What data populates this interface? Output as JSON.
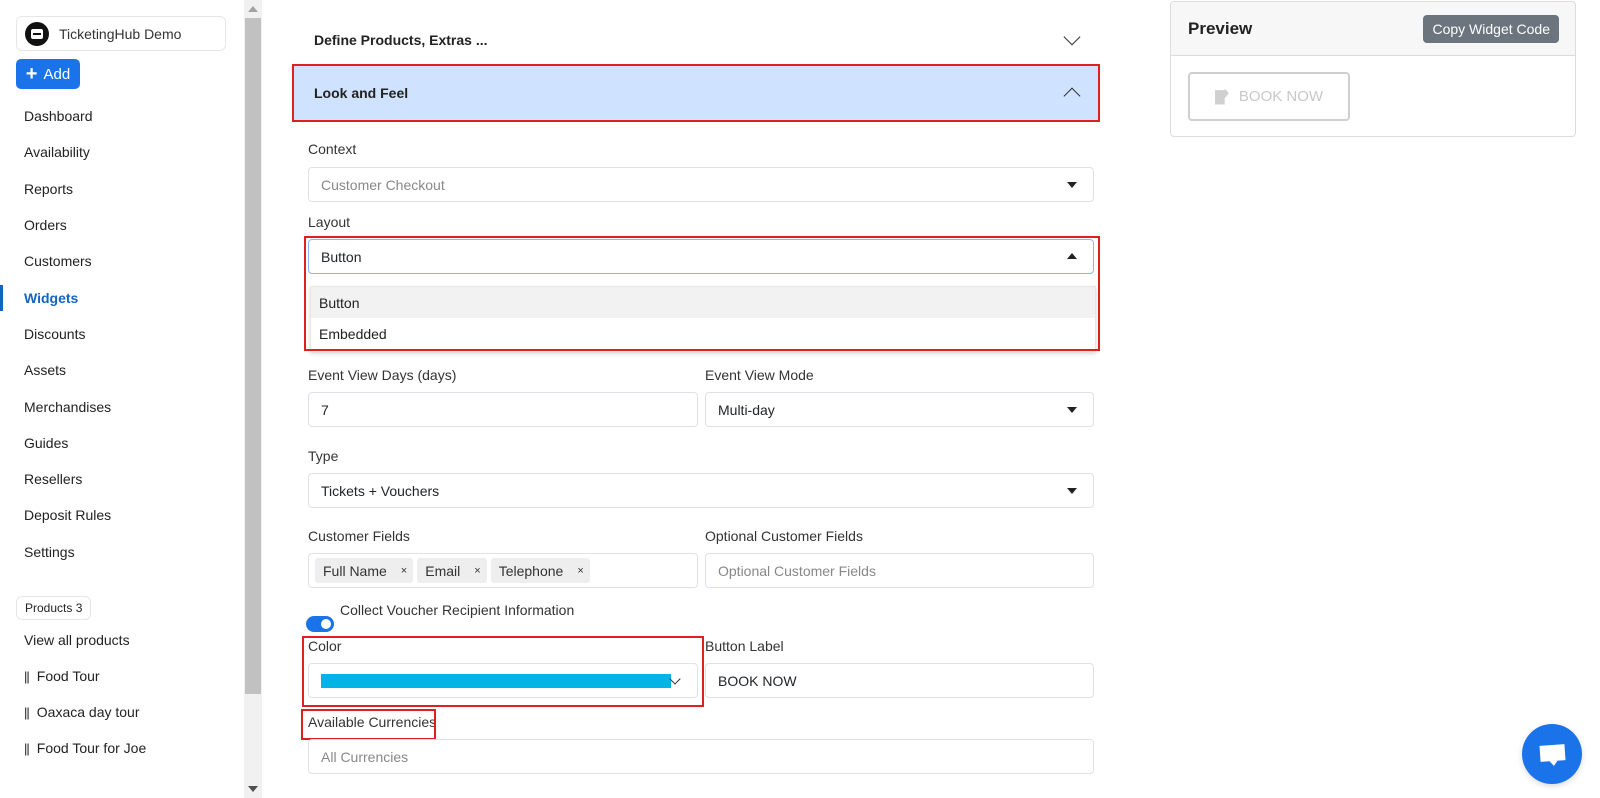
{
  "sidebar": {
    "brand": "TicketingHub Demo",
    "add_label": "Add",
    "items": [
      {
        "label": "Dashboard"
      },
      {
        "label": "Availability"
      },
      {
        "label": "Reports"
      },
      {
        "label": "Orders"
      },
      {
        "label": "Customers"
      },
      {
        "label": "Widgets",
        "active": true
      },
      {
        "label": "Discounts"
      },
      {
        "label": "Assets"
      },
      {
        "label": "Merchandises"
      },
      {
        "label": "Guides"
      },
      {
        "label": "Resellers"
      },
      {
        "label": "Deposit Rules"
      },
      {
        "label": "Settings"
      }
    ],
    "products_badge": "Products 3",
    "products": [
      {
        "label": "View all products"
      },
      {
        "label": "Food Tour"
      },
      {
        "label": "Oaxaca day tour"
      },
      {
        "label": "Food Tour for Joe"
      }
    ],
    "grip": "||"
  },
  "main": {
    "section1": "Define Products, Extras ...",
    "section2": "Look and Feel",
    "context_label": "Context",
    "context_value": "Customer Checkout",
    "layout_label": "Layout",
    "layout_value": "Button",
    "layout_options": [
      "Button",
      "Embedded"
    ],
    "event_days_label": "Event View Days (days)",
    "event_days_value": "7",
    "event_mode_label": "Event View Mode",
    "event_mode_value": "Multi-day",
    "type_label": "Type",
    "type_value": "Tickets + Vouchers",
    "customer_fields_label": "Customer Fields",
    "customer_fields": [
      "Full Name",
      "Email",
      "Telephone"
    ],
    "tag_remove": "×",
    "optional_fields_label": "Optional Customer Fields",
    "optional_fields_placeholder": "Optional Customer Fields",
    "voucher_toggle_label": "Collect Voucher Recipient Information",
    "voucher_toggle_on": true,
    "color_label": "Color",
    "color_value": "#00b4e6",
    "button_label_label": "Button Label",
    "button_label_value": "BOOK NOW",
    "currencies_label": "Available Currencies",
    "currencies_placeholder": "All Currencies"
  },
  "preview": {
    "title": "Preview",
    "copy_label": "Copy Widget Code",
    "book_label": "BOOK NOW"
  }
}
